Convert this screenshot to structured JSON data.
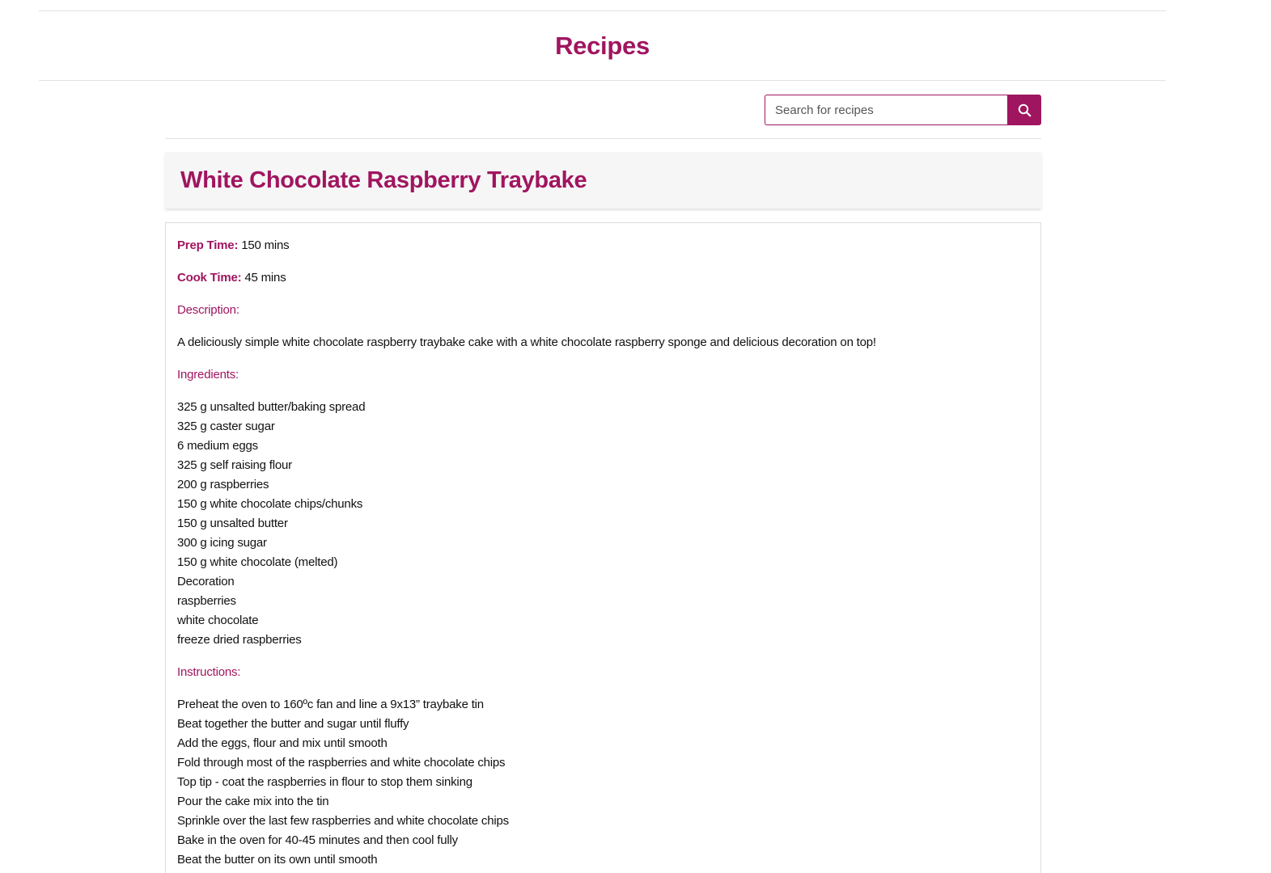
{
  "header": {
    "title": "Recipes"
  },
  "search": {
    "placeholder": "Search for recipes",
    "icon": "search-icon"
  },
  "recipe": {
    "title": "White Chocolate Raspberry Traybake",
    "prep_label": "Prep Time:",
    "prep_value": "150 mins",
    "cook_label": "Cook Time:",
    "cook_value": "45 mins",
    "description_label": "Description:",
    "description": "A deliciously simple white chocolate raspberry traybake cake with a white chocolate raspberry sponge and delicious decoration on top!",
    "ingredients_label": "Ingredients:",
    "ingredients": [
      "325 g unsalted butter/baking spread",
      "325 g caster sugar",
      "6 medium eggs",
      "325 g self raising flour",
      "200 g raspberries",
      "150 g white chocolate chips/chunks",
      "150 g unsalted butter",
      "300 g icing sugar",
      "150 g white chocolate (melted)",
      "Decoration",
      "raspberries",
      "white chocolate",
      "freeze dried raspberries"
    ],
    "instructions_label": "Instructions:",
    "instructions": [
      "Preheat the oven to 160ºc fan and line a 9x13” traybake tin",
      "Beat together the butter and sugar until fluffy",
      "Add the eggs, flour and mix until smooth",
      "Fold through most of the raspberries and white chocolate chips",
      "Top tip - coat the raspberries in flour to stop them sinking",
      "Pour the cake mix into the tin",
      "Sprinkle over the last few raspberries and white chocolate chips",
      "Bake in the oven for 40-45 minutes and then cool fully",
      "Beat the butter on its own until smooth"
    ]
  },
  "colors": {
    "accent": "#a0155f",
    "title_bar_bg": "#f6f6f6",
    "border": "#dcdcdc"
  }
}
